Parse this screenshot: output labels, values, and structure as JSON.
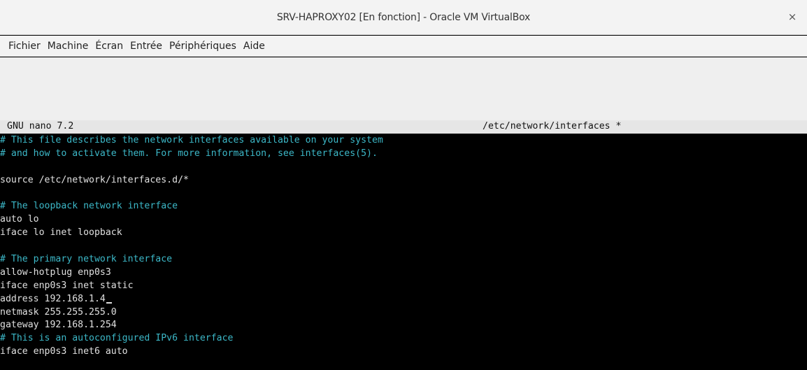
{
  "window": {
    "title": "SRV-HAPROXY02 [En fonction] - Oracle VM VirtualBox",
    "close_symbol": "×"
  },
  "menu": {
    "items": [
      "Fichier",
      "Machine",
      "Écran",
      "Entrée",
      "Périphériques",
      "Aide"
    ]
  },
  "nano": {
    "version": "GNU nano 7.2",
    "filename": "/etc/network/interfaces *",
    "lines": [
      {
        "text": "# This file describes the network interfaces available on your system",
        "type": "comment"
      },
      {
        "text": "# and how to activate them. For more information, see interfaces(5).",
        "type": "comment"
      },
      {
        "text": "",
        "type": "blank"
      },
      {
        "text": "source /etc/network/interfaces.d/*",
        "type": "code"
      },
      {
        "text": "",
        "type": "blank"
      },
      {
        "text": "# The loopback network interface",
        "type": "comment"
      },
      {
        "text": "auto lo",
        "type": "code"
      },
      {
        "text": "iface lo inet loopback",
        "type": "code"
      },
      {
        "text": "",
        "type": "blank"
      },
      {
        "text": "# The primary network interface",
        "type": "comment"
      },
      {
        "text": "allow-hotplug enp0s3",
        "type": "code"
      },
      {
        "text": "iface enp0s3 inet static",
        "type": "code"
      },
      {
        "text": "address 192.168.1.4",
        "type": "code"
      },
      {
        "text": "netmask 255.255.255.0",
        "type": "code"
      },
      {
        "text": "gateway 192.168.1.254",
        "type": "code"
      },
      {
        "text": "# This is an autoconfigured IPv6 interface",
        "type": "comment"
      },
      {
        "text": "iface enp0s3 inet6 auto",
        "type": "code"
      }
    ],
    "cursor_line": 12
  }
}
